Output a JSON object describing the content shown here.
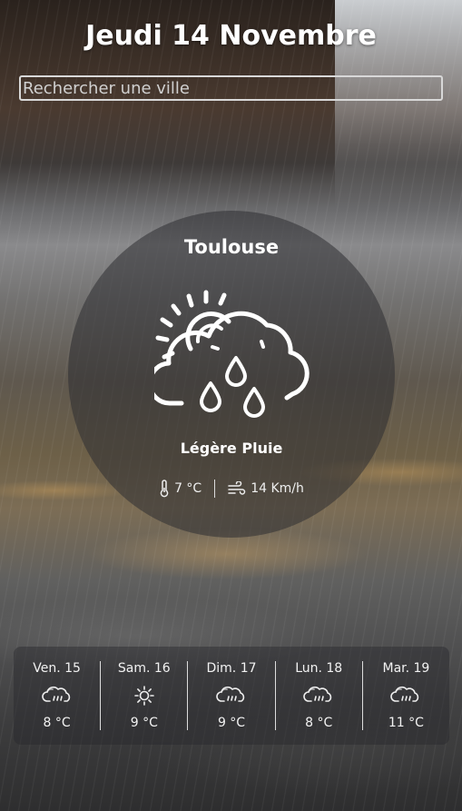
{
  "header": {
    "date": "Jeudi 14 Novembre"
  },
  "search": {
    "placeholder": "Rechercher une ville"
  },
  "current": {
    "city": "Toulouse",
    "condition": "Légère Pluie",
    "condition_icon": "sun-cloud-rain-icon",
    "temperature": "7 °C",
    "wind": "14 Km/h"
  },
  "forecast": [
    {
      "day": "Ven. 15",
      "icon": "cloud-rain-icon",
      "temp": "8 °C"
    },
    {
      "day": "Sam. 16",
      "icon": "sun-icon",
      "temp": "9 °C"
    },
    {
      "day": "Dim. 17",
      "icon": "cloud-rain-icon",
      "temp": "9 °C"
    },
    {
      "day": "Lun. 18",
      "icon": "cloud-rain-icon",
      "temp": "8 °C"
    },
    {
      "day": "Mar. 19",
      "icon": "cloud-rain-icon",
      "temp": "11 °C"
    }
  ]
}
